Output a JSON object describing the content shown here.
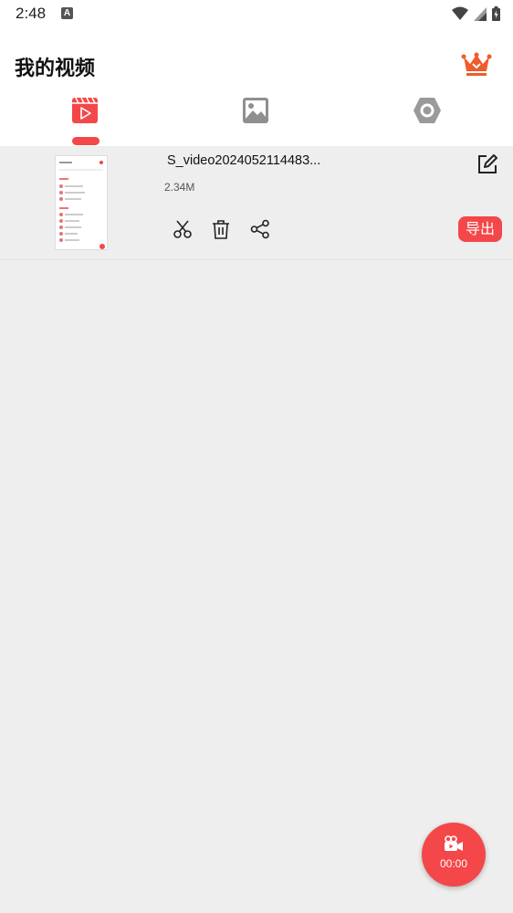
{
  "status_bar": {
    "time": "2:48"
  },
  "header": {
    "title": "我的视频"
  },
  "video_item": {
    "name": "S_video2024052114483...",
    "size": "2.34M",
    "export_label": "导出"
  },
  "record": {
    "time": "00:00"
  },
  "colors": {
    "accent": "#f44749",
    "background": "#eeeeee",
    "vip": "#ef5b2b"
  },
  "icons": {
    "tabs": [
      "video-tab-icon",
      "image-tab-icon",
      "settings-tab-icon"
    ],
    "actions": [
      "scissors-icon",
      "trash-icon",
      "share-icon"
    ]
  }
}
